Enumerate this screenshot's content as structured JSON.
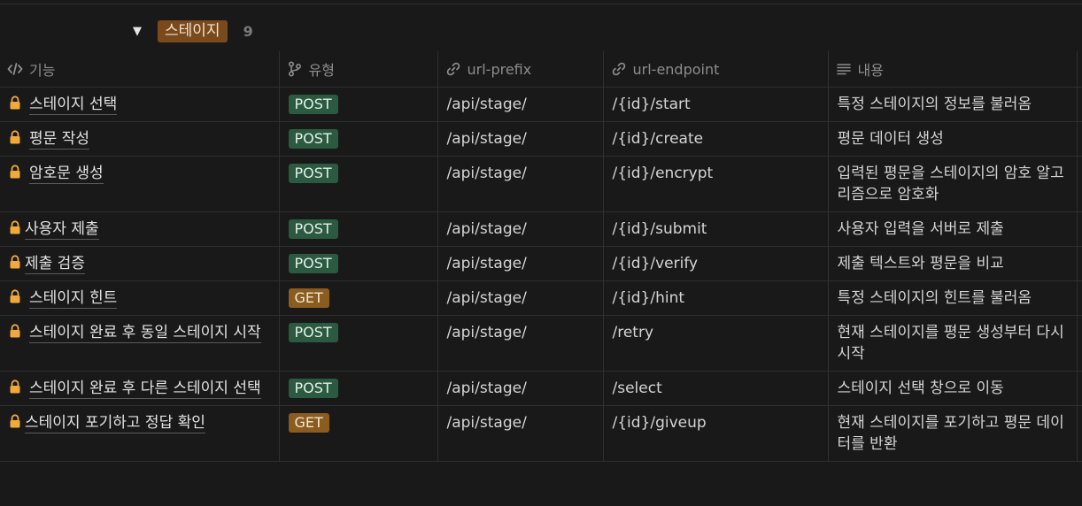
{
  "group": {
    "toggle_icon": "triangle-down-icon",
    "tag_label": "스테이지",
    "count": "9"
  },
  "columns": [
    {
      "label": "기능",
      "icon": "code-icon"
    },
    {
      "label": "유형",
      "icon": "branch-icon"
    },
    {
      "label": "url-prefix",
      "icon": "link-icon"
    },
    {
      "label": "url-endpoint",
      "icon": "link-icon"
    },
    {
      "label": "내용",
      "icon": "text-lines-icon"
    }
  ],
  "colors": {
    "post_badge": "#2b5a41",
    "get_badge": "#8a5c1f",
    "group_tag": "#7a4a1c",
    "lock": "#f2a93b"
  },
  "rows": [
    {
      "name": "스테이지 선택",
      "method": "POST",
      "prefix": "/api/stage/",
      "endpoint": "/{id}/start",
      "desc": "특정 스테이지의 정보를 불러옴"
    },
    {
      "name": "평문 작성",
      "method": "POST",
      "prefix": "/api/stage/",
      "endpoint": "/{id}/create",
      "desc": "평문 데이터 생성"
    },
    {
      "name": "암호문 생성",
      "method": "POST",
      "prefix": "/api/stage/",
      "endpoint": "/{id}/encrypt",
      "desc": "입력된 평문을 스테이지의 암호 알고리즘으로 암호화"
    },
    {
      "name": "사용자 제출",
      "method": "POST",
      "prefix": "/api/stage/",
      "endpoint": "/{id}/submit",
      "desc": "사용자 입력을 서버로 제출"
    },
    {
      "name": "제출 검증",
      "method": "POST",
      "prefix": "/api/stage/",
      "endpoint": "/{id}/verify",
      "desc": "제출 텍스트와 평문을 비교"
    },
    {
      "name": "스테이지 힌트",
      "method": "GET",
      "prefix": "/api/stage/",
      "endpoint": "/{id}/hint",
      "desc": "특정 스테이지의 힌트를 불러옴"
    },
    {
      "name": "스테이지 완료 후 동일 스테이지 시작",
      "method": "POST",
      "prefix": "/api/stage/",
      "endpoint": "/retry",
      "desc": "현재 스테이지를 평문 생성부터 다시 시작"
    },
    {
      "name": "스테이지 완료 후 다른 스테이지 선택",
      "method": "POST",
      "prefix": "/api/stage/",
      "endpoint": "/select",
      "desc": "스테이지 선택 창으로 이동"
    },
    {
      "name": "스테이지 포기하고 정답 확인",
      "method": "GET",
      "prefix": "/api/stage/",
      "endpoint": "/{id}/giveup",
      "desc": "현재 스테이지를 포기하고 평문 데이터를 반환"
    }
  ]
}
